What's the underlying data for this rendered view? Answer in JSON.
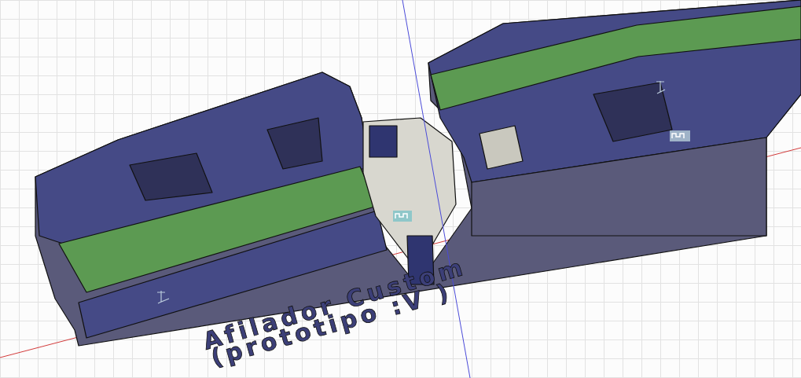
{
  "viewport": {
    "model": {
      "engraving": [
        "Afilador Custom",
        "(prototipo :V )"
      ]
    }
  }
}
